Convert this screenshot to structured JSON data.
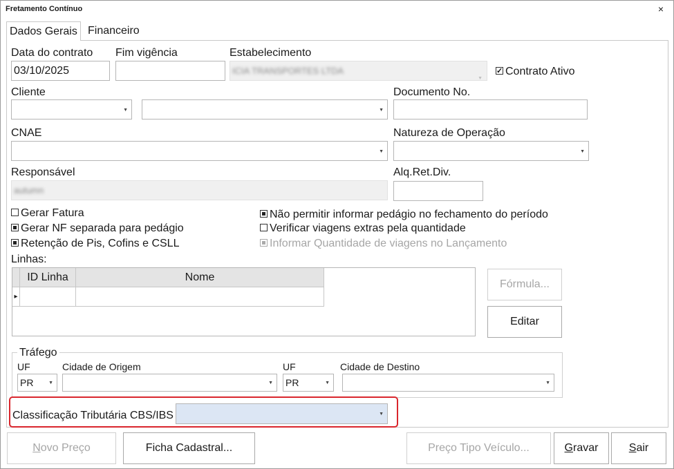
{
  "window": {
    "title": "Fretamento Contínuo",
    "close_glyph": "×"
  },
  "tabs": [
    {
      "label": "Dados Gerais",
      "active": true
    },
    {
      "label": "Financeiro",
      "active": false
    }
  ],
  "fields": {
    "data_contrato": {
      "label": "Data do contrato",
      "value": "03/10/2025"
    },
    "fim_vigencia": {
      "label": "Fim vigência",
      "value": ""
    },
    "estabelecimento": {
      "label": "Estabelecimento",
      "value": "ICIA TRANSPORTES LTDA"
    },
    "contrato_ativo": {
      "label": "Contrato Ativo",
      "checked": true
    },
    "cliente": {
      "label": "Cliente",
      "code": "",
      "name": ""
    },
    "documento": {
      "label": "Documento No.",
      "value": ""
    },
    "cnae": {
      "label": "CNAE",
      "value": ""
    },
    "natureza": {
      "label": "Natureza de Operação",
      "value": ""
    },
    "responsavel": {
      "label": "Responsável",
      "value": "autumn"
    },
    "alq_ret_div": {
      "label": "Alq.Ret.Div.",
      "value": ""
    }
  },
  "checkboxes": {
    "gerar_fatura": {
      "label": "Gerar Fatura",
      "checked": false
    },
    "gerar_nf": {
      "label": "Gerar NF separada para pedágio",
      "checked": true
    },
    "retencao": {
      "label": "Retenção de Pis, Cofins e CSLL",
      "checked": true
    },
    "nao_permitir": {
      "label": "Não permitir informar pedágio no fechamento do período",
      "checked": true
    },
    "verificar": {
      "label": "Verificar viagens extras pela quantidade",
      "checked": false
    },
    "informar_qtd": {
      "label": "Informar Quantidade de viagens no Lançamento",
      "checked": true,
      "disabled": true
    }
  },
  "linhas": {
    "label": "Linhas:",
    "columns": [
      "ID Linha",
      "Nome"
    ],
    "row_indicator": "▸",
    "rows": [
      {
        "id": "",
        "nome": ""
      }
    ]
  },
  "side_buttons": {
    "formula": "Fórmula...",
    "editar": "Editar"
  },
  "trafego": {
    "legend": "Tráfego",
    "uf_label": "UF",
    "origem_label": "Cidade de Origem",
    "destino_label": "Cidade de Destino",
    "uf_origem": "PR",
    "uf_destino": "PR",
    "cidade_origem": "",
    "cidade_destino": ""
  },
  "classificacao": {
    "label": "Classificação Tributária CBS/IBS",
    "value": ""
  },
  "footer": {
    "novo_preco": {
      "label_first": "N",
      "label_rest": "ovo Preço"
    },
    "ficha": "Ficha Cadastral...",
    "preco_tipo": "Preço Tipo Veículo...",
    "gravar": {
      "label_first": "G",
      "label_rest": "ravar"
    },
    "sair": {
      "label_first": "S",
      "label_rest": "air"
    }
  },
  "colors": {
    "highlight_border": "#d9252c",
    "selected_combo_bg": "#dce6f4"
  }
}
